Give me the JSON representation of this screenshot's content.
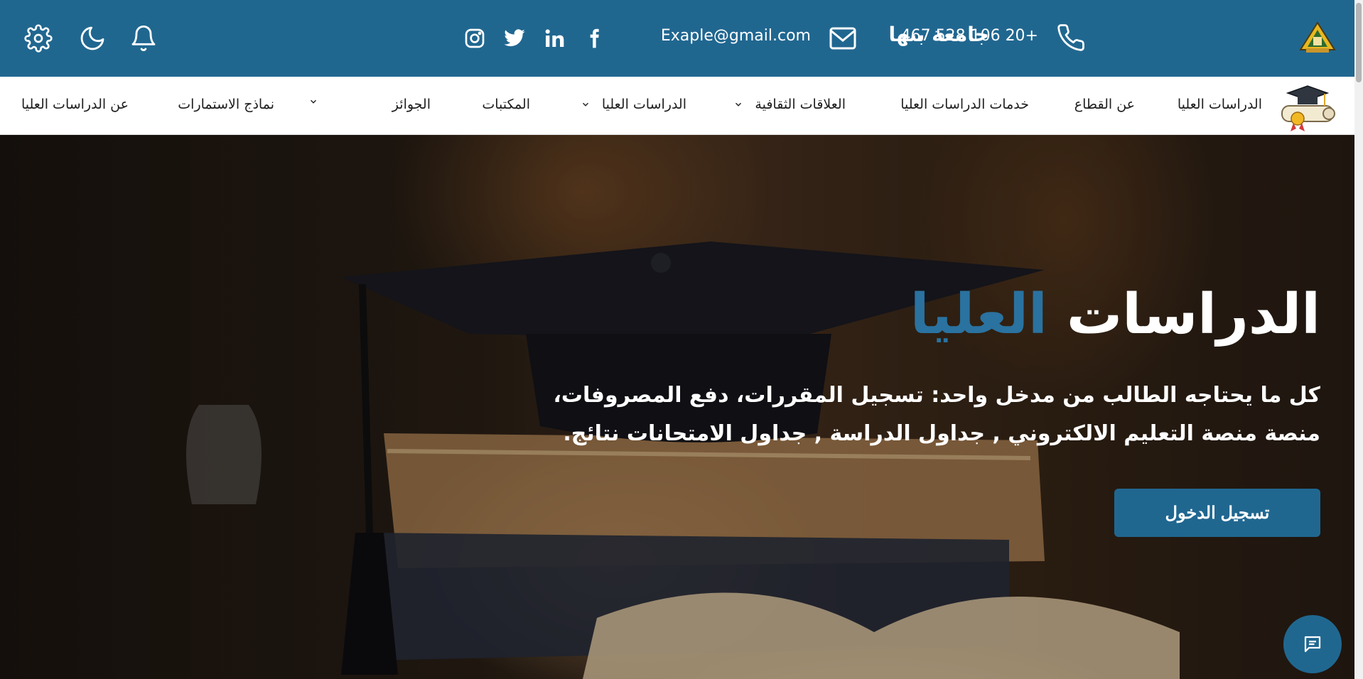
{
  "topbar": {
    "university_name": "جامعة بنها",
    "phone": "467 528 106 20+",
    "email": "Exaple@gmail.com",
    "bg_color": "#206790",
    "social_icons": [
      "facebook-icon",
      "linkedin-icon",
      "twitter-icon",
      "instagram-icon"
    ],
    "utility_icons": [
      "bell-icon",
      "moon-icon",
      "gear-icon"
    ]
  },
  "nav": {
    "brand": "الدراسات العليا",
    "items": [
      {
        "label": "عن القطاع",
        "has_dropdown": false
      },
      {
        "label": "خدمات الدراسات العليا",
        "has_dropdown": false
      },
      {
        "label": "العلاقات الثقافية",
        "has_dropdown": true
      },
      {
        "label": "الدراسات العليا",
        "has_dropdown": true
      },
      {
        "label": "المكتبات",
        "has_dropdown": false
      },
      {
        "label": "الجوائز",
        "has_dropdown": false
      },
      {
        "label": "",
        "has_dropdown": true
      },
      {
        "label": "نماذج الاستمارات",
        "has_dropdown": false
      },
      {
        "label": "عن الدراسات العليا",
        "has_dropdown": false
      }
    ]
  },
  "hero": {
    "title_main": "الدراسات",
    "title_accent": "العليا",
    "accent_color": "#2a72a0",
    "description": "كل ما يحتاجه الطالب من مدخل واحد: تسجيل المقررات، دفع المصروفات، منصة منصة التعليم الالكتروني , جداول الدراسة , جداول الامتحانات نتائج.",
    "login_button": "تسجيل الدخول"
  },
  "chat": {
    "icon": "chat-icon"
  }
}
